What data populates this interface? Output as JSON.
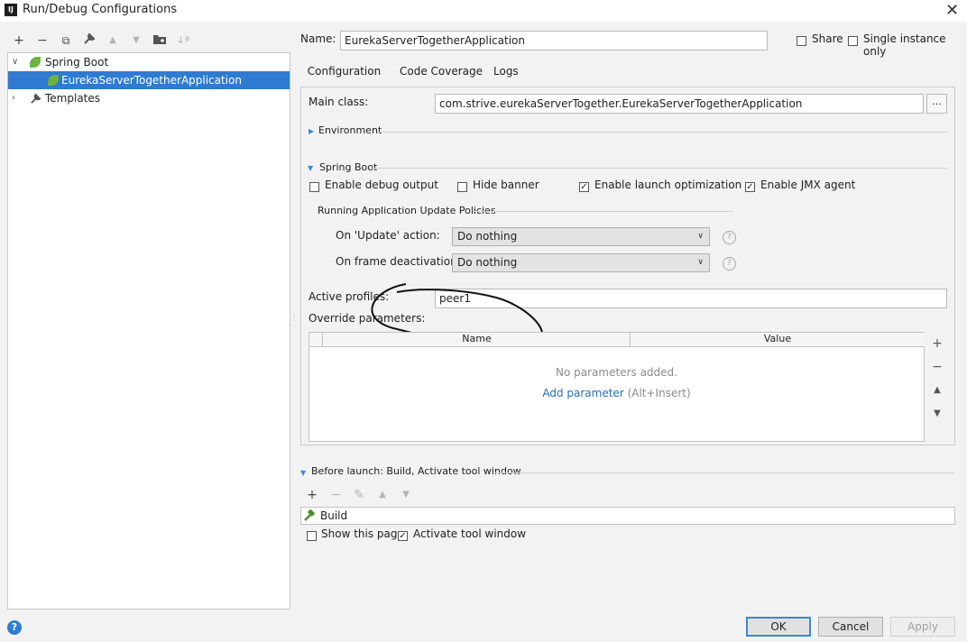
{
  "window": {
    "title": "Run/Debug Configurations",
    "app_icon_text": "IJ"
  },
  "toolbar": {
    "add": "+",
    "remove": "−",
    "copy": "⧉",
    "edit": "🔧",
    "up": "▲",
    "down": "▼",
    "folder": "▰",
    "sort": "↓ª"
  },
  "tree": {
    "group_label": "Spring Boot",
    "selected_item": "EurekaServerTogetherApplication",
    "templates_label": "Templates"
  },
  "header": {
    "name_label": "Name:",
    "name_value": "EurekaServerTogetherApplication",
    "share_label": "Share",
    "single_instance_label": "Single instance only"
  },
  "tabs": [
    "Configuration",
    "Code Coverage",
    "Logs"
  ],
  "config": {
    "main_class_label": "Main class:",
    "main_class_value": "com.strive.eurekaServerTogether.EurekaServerTogetherApplication",
    "browse_label": "...",
    "environment_label": "Environment",
    "spring_boot_label": "Spring Boot",
    "enable_debug_label": "Enable debug output",
    "hide_banner_label": "Hide banner",
    "launch_opt_label": "Enable launch optimization",
    "jmx_label": "Enable JMX agent",
    "update_policies_label": "Running Application Update Policies",
    "update_action_label": "On 'Update' action:",
    "update_action_value": "Do nothing",
    "frame_deactivation_label": "On frame deactivation:",
    "frame_deactivation_value": "Do nothing",
    "active_profiles_label": "Active profiles:",
    "active_profiles_value": "peer1",
    "override_label": "Override parameters:",
    "table": {
      "columns": [
        "Name",
        "Value"
      ],
      "empty_text": "No parameters added.",
      "add_link": "Add parameter",
      "add_shortcut": "(Alt+Insert)"
    },
    "side_buttons": {
      "add": "+",
      "remove": "−",
      "up": "▲",
      "down": "▼"
    }
  },
  "before_launch": {
    "label": "Before launch: Build, Activate tool window",
    "toolbar": {
      "add": "+",
      "remove": "−",
      "edit": "✎",
      "up": "▲",
      "down": "▼"
    },
    "task": "Build",
    "show_page_label": "Show this page",
    "activate_label": "Activate tool window"
  },
  "footer": {
    "help": "?",
    "ok": "OK",
    "cancel": "Cancel",
    "apply": "Apply"
  },
  "checks": {
    "checked": "✓"
  },
  "colors": {
    "accent": "#2e7bd1",
    "link": "#2470b3",
    "spring_green": "#6db33f"
  }
}
